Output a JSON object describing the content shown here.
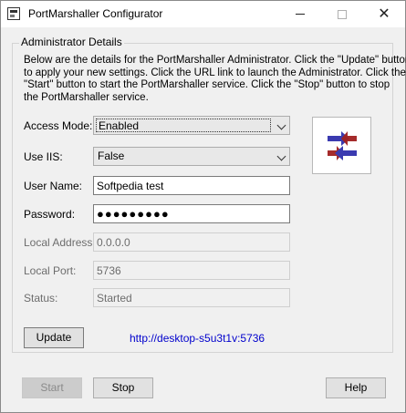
{
  "window": {
    "title": "PortMarshaller Configurator",
    "icons": {
      "app": "app-window-icon",
      "minimize": "minimize-icon",
      "maximize": "maximize-icon",
      "close": "close-icon"
    }
  },
  "group": {
    "title": "Administrator Details",
    "description_lines": [
      "Below are the details for the PortMarshaller Administrator.  Click the \"Update\" button",
      "to apply your new settings.  Click the URL link to launch the Administrator.  Click the",
      "\"Start\" button to start the PortMarshaller service.  Click the \"Stop\" button to stop",
      "the PortMarshaller service."
    ]
  },
  "fields": {
    "access_mode": {
      "label": "Access Mode:",
      "value": "Enabled"
    },
    "use_iis": {
      "label": "Use IIS:",
      "value": "False"
    },
    "user_name": {
      "label": "User Name:",
      "value": "Softpedia test"
    },
    "password": {
      "label": "Password:",
      "value": "●●●●●●●●●"
    },
    "local_address": {
      "label": "Local Address:",
      "value": "0.0.0.0"
    },
    "local_port": {
      "label": "Local Port:",
      "value": "5736"
    },
    "status": {
      "label": "Status:",
      "value": "Started"
    }
  },
  "logo_icon": "swap-arrows-icon",
  "colors": {
    "arrow_blue": "#3a3ab0",
    "arrow_red": "#a02020",
    "link": "#0000cc"
  },
  "update_button": "Update",
  "admin_url": "http://desktop-s5u3t1v:5736",
  "footer": {
    "start": "Start",
    "stop": "Stop",
    "help": "Help"
  }
}
